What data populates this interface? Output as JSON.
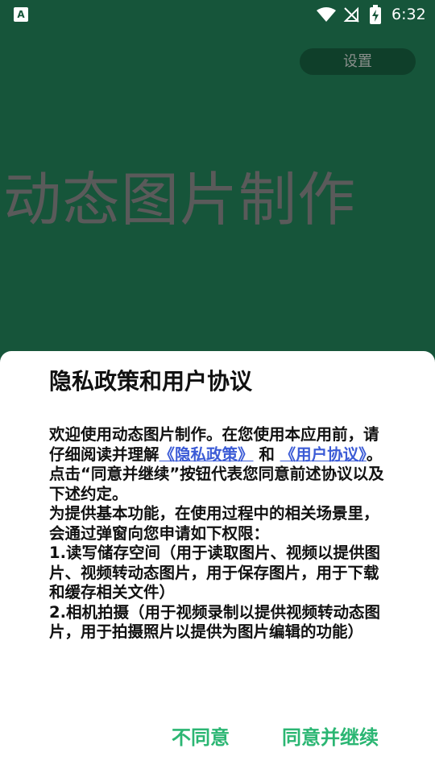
{
  "status_bar": {
    "app_icon_glyph": "A",
    "time": "6:32",
    "icons": [
      "wifi-icon",
      "no-signal-icon",
      "battery-charging-icon"
    ]
  },
  "header": {
    "settings_label": "设置"
  },
  "main": {
    "title": "动态图片制作"
  },
  "dialog": {
    "title": "隐私政策和用户协议",
    "intro_prefix": "欢迎使用动态图片制作。在您使用本应用前，请仔细阅读并理解",
    "privacy_link": "《隐私政策》",
    "and_text": " 和 ",
    "agreement_link": "《用户协议》",
    "intro_suffix": "。点击“同意并继续”按钮代表您同意前述协议以及下述约定。",
    "para2": "为提供基本功能，在使用过程中的相关场景里，会通过弹窗向您申请如下权限：",
    "perm1": "1.读写储存空间（用于读取图片、视频以提供图片、视频转动态图片，用于保存图片，用于下载和缓存相关文件）",
    "perm2": "2.相机拍摄（用于视频录制以提供视频转动态图片，用于拍摄照片以提供为图片编辑的功能）",
    "disagree_label": "不同意",
    "agree_label": "同意并继续"
  },
  "colors": {
    "background": "#16553a",
    "accent": "#2bb673",
    "link": "#3b5bd6"
  }
}
